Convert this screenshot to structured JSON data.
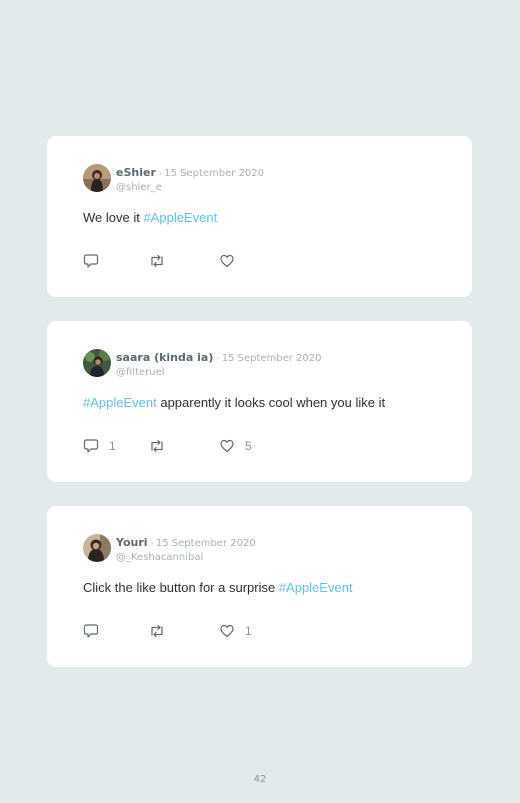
{
  "tweets": [
    {
      "name": "eShier",
      "separator": "·",
      "date": "15 September 2020",
      "handle": "@shier_e",
      "text_before": "We love it ",
      "hashtag": "#AppleEvent",
      "text_after": "",
      "replies": "",
      "retweets": "",
      "likes": ""
    },
    {
      "name": "saara (kinda ia)",
      "separator": "·",
      "date": "15 September 2020",
      "handle": "@filteruel",
      "text_before": "",
      "hashtag": "#AppleEvent",
      "text_after": " apparently it looks cool when you like it",
      "replies": "1",
      "retweets": "",
      "likes": "5"
    },
    {
      "name": "Youri",
      "separator": "·",
      "date": "15 September 2020",
      "handle": "@_Keshacannibal",
      "text_before": "Click the like button for a surprise ",
      "hashtag": "#AppleEvent",
      "text_after": "",
      "replies": "",
      "retweets": "",
      "likes": "1"
    }
  ],
  "icons": {
    "reply": "reply-icon",
    "retweet": "retweet-icon",
    "like": "heart-icon"
  },
  "colors": {
    "background": "#e3eaec",
    "card": "#ffffff",
    "hashtag": "#62c3e6",
    "muted": "#a8b2b7"
  },
  "page_number": "42"
}
